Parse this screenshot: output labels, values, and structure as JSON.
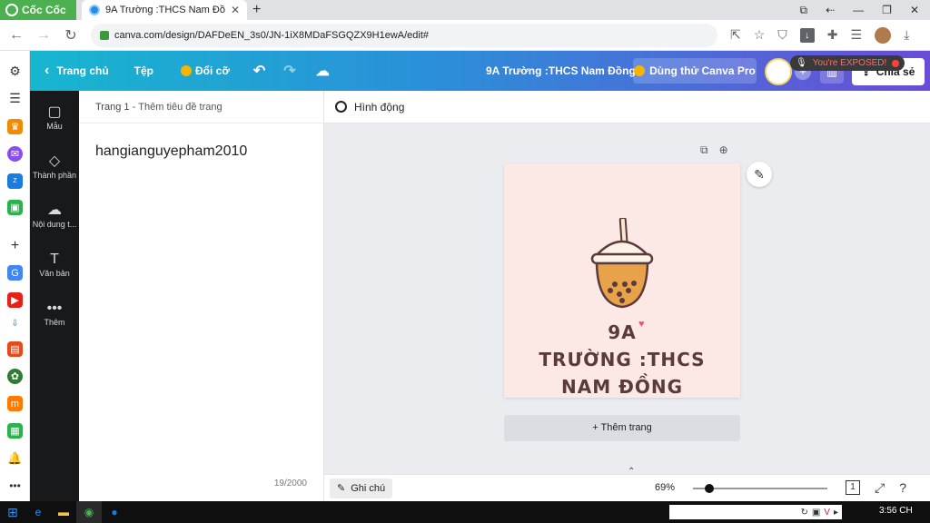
{
  "browser": {
    "brand": "Cốc Cốc",
    "tab_title": "9A Trường :THCS Nam Đồng",
    "url": "canva.com/design/DAFDeEN_3s0/JN-1iX8MDaFSGQZX9H1ewA/edit#"
  },
  "canva_top": {
    "home": "Trang chủ",
    "file": "Tệp",
    "resize": "Đổi cỡ",
    "doc_title": "9A Trường :THCS Nam Đồng",
    "pro": "Dùng thử Canva Pro",
    "share": "Chia sẻ",
    "exposed": "You're EXPOSED!"
  },
  "rail": [
    {
      "icon": "layout-icon",
      "glyph": "▢",
      "label": "Mẫu"
    },
    {
      "icon": "shapes-icon",
      "glyph": "◇",
      "label": "Thành phần"
    },
    {
      "icon": "upload-icon",
      "glyph": "☁",
      "label": "Nội dung t..."
    },
    {
      "icon": "text-icon",
      "glyph": "T",
      "label": "Văn bản"
    },
    {
      "icon": "more-icon",
      "glyph": "•••",
      "label": "Thêm"
    }
  ],
  "notes_panel": {
    "page_label": "Trang 1",
    "page_title_hint": "Thêm tiêu đề trang",
    "note_text": "hangianguyepham2010",
    "char_count": "19/2000"
  },
  "editor": {
    "animate": "Hình động",
    "design_lines": [
      "9A",
      "TRƯỜNG :THCS",
      "NAM ĐỒNG"
    ],
    "add_page": "+ Thêm trang",
    "notes_button": "Ghi chú",
    "zoom": "69%",
    "zoom_fraction": 0.12,
    "page_count": "1"
  },
  "taskbar": {
    "clock": "3:56 CH"
  }
}
